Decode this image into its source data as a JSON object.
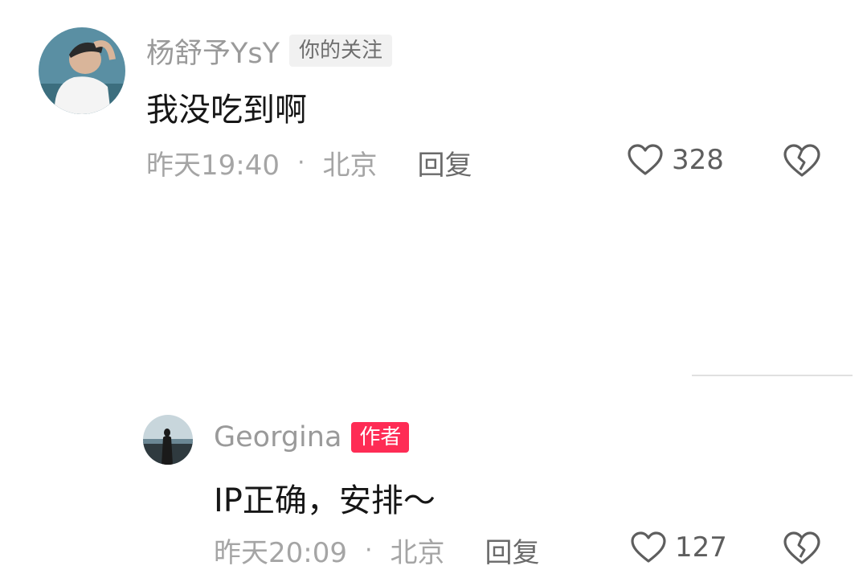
{
  "comments": [
    {
      "username": "杨舒予YsY",
      "badge": "你的关注",
      "text": "我没吃到啊",
      "time": "昨天19:40",
      "separator": "·",
      "location": "北京",
      "reply_label": "回复",
      "like_count": "328",
      "avatar_icon": "user-avatar-photo"
    },
    {
      "username": "Georgina",
      "badge": "作者",
      "text": "IP正确，安排～",
      "time": "昨天20:09",
      "separator": "·",
      "location": "北京",
      "reply_label": "回复",
      "like_count": "127",
      "avatar_icon": "user-avatar-photo"
    }
  ],
  "icons": {
    "like": "heart-outline-icon",
    "dislike": "broken-heart-icon"
  },
  "colors": {
    "author_badge": "#fe2c55",
    "follow_badge_bg": "#f1f1f1",
    "muted_text": "#9a9a9a",
    "body_text": "#161616"
  }
}
